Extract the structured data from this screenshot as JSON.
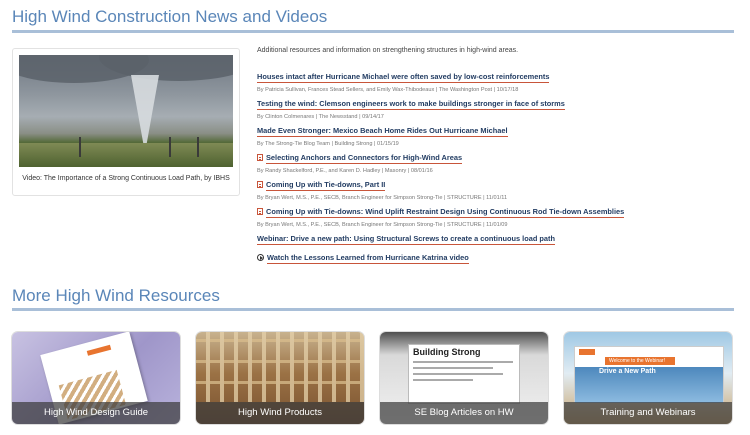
{
  "sections": {
    "news_title": "High Wind Construction News and Videos",
    "resources_title": "More High Wind Resources"
  },
  "video": {
    "caption": "Video: The Importance of a Strong Continuous Load Path, by IBHS"
  },
  "intro": "Additional resources and information on strengthening structures in high-wind areas.",
  "articles": [
    {
      "title": "Houses intact after Hurricane Michael were often saved by low-cost reinforcements",
      "meta": "By Patricia Sullivan, Frances Stead Sellers, and Emily Wax-Thibodeaux | The Washington Post | 10/17/18",
      "icon": "none"
    },
    {
      "title": "Testing the wind: Clemson engineers work to make buildings stronger in face of storms",
      "meta": "By Clinton Colmenares | The Newsstand | 09/14/17",
      "icon": "none"
    },
    {
      "title": "Made Even Stronger: Mexico Beach Home Rides Out Hurricane Michael",
      "meta": "By The Strong-Tie Blog Team | Building Strong | 01/15/19",
      "icon": "none"
    },
    {
      "title": "Selecting Anchors and Connectors for High-Wind Areas",
      "meta": "By Randy Shackelford, P.E., and Karen D. Hadley | Masonry | 08/01/16",
      "icon": "pdf-icon"
    },
    {
      "title": "Coming Up with Tie-downs, Part II",
      "meta": "By Bryan Wert, M.S., P.E., SECB, Branch Engineer for Simpson Strong-Tie | STRUCTURE | 11/01/11",
      "icon": "pdf-icon"
    },
    {
      "title": "Coming Up with Tie-downs: Wind Uplift Restraint Design Using Continuous Rod Tie-down Assemblies",
      "meta": "By Bryan Wert, M.S., P.E., SECB, Branch Engineer for Simpson Strong-Tie | STRUCTURE | 11/01/09",
      "icon": "pdf-icon"
    },
    {
      "title": "Webinar: Drive a new path: Using Structural Screws to create a continuous load path",
      "meta": "",
      "icon": "none"
    },
    {
      "title": "Watch the Lessons Learned from Hurricane Katrina video",
      "meta": "",
      "icon": "play-icon"
    }
  ],
  "cards": [
    {
      "label": "High Wind Design Guide"
    },
    {
      "label": "High Wind Products"
    },
    {
      "label": "SE Blog Articles on HW",
      "thumb_title": "Building Strong"
    },
    {
      "label": "Training and Webinars",
      "banner": "Welcome to the Webinar!",
      "thumb_title": "Drive a New Path"
    }
  ],
  "colors": {
    "heading": "#5a86b8",
    "rule": "#a9bfd8",
    "link": "#233d63",
    "link_underline": "#c8553a"
  }
}
